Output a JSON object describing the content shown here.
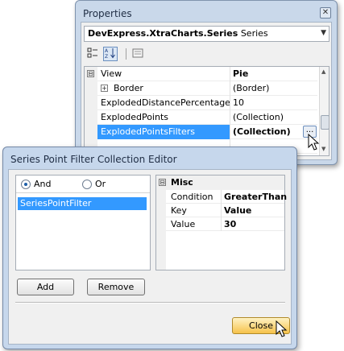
{
  "properties_window": {
    "title": "Properties",
    "close_glyph": "✕",
    "object_selector": {
      "type_name": "DevExpress.XtraCharts.Series",
      "object_name": "Series"
    },
    "toolbar": {
      "categorized_icon": "categorized-icon",
      "alphabetical_icon": "alphabetical-icon",
      "property_pages_icon": "property-pages-icon"
    },
    "rows": [
      {
        "name": "View",
        "value": "Pie",
        "expander": "⊟",
        "value_bold": true,
        "category": true
      },
      {
        "name": "Border",
        "value": "(Border)",
        "expander": "+"
      },
      {
        "name": "ExplodedDistancePercentage",
        "value": "10"
      },
      {
        "name": "ExplodedPoints",
        "value": "(Collection)"
      },
      {
        "name": "ExplodedPointsFilters",
        "value": "(Collection)",
        "selected": true,
        "value_bold": true
      }
    ],
    "ellipsis_label": "..."
  },
  "editor_window": {
    "title": "Series Point Filter Collection Editor",
    "radio_and_label": "And",
    "radio_or_label": "Or",
    "selected_radio": "And",
    "filters": [
      "SeriesPointFilter"
    ],
    "property_category": "Misc",
    "property_category_glyph": "⊟",
    "properties": [
      {
        "name": "Condition",
        "value": "GreaterThan"
      },
      {
        "name": "Key",
        "value": "Value"
      },
      {
        "name": "Value",
        "value": "30"
      }
    ],
    "add_label": "Add",
    "remove_label": "Remove",
    "close_label": "Close"
  },
  "colors": {
    "selection": "#3399ff",
    "window_frame": "#c6d7ec",
    "close_button": "#f6c24a"
  }
}
